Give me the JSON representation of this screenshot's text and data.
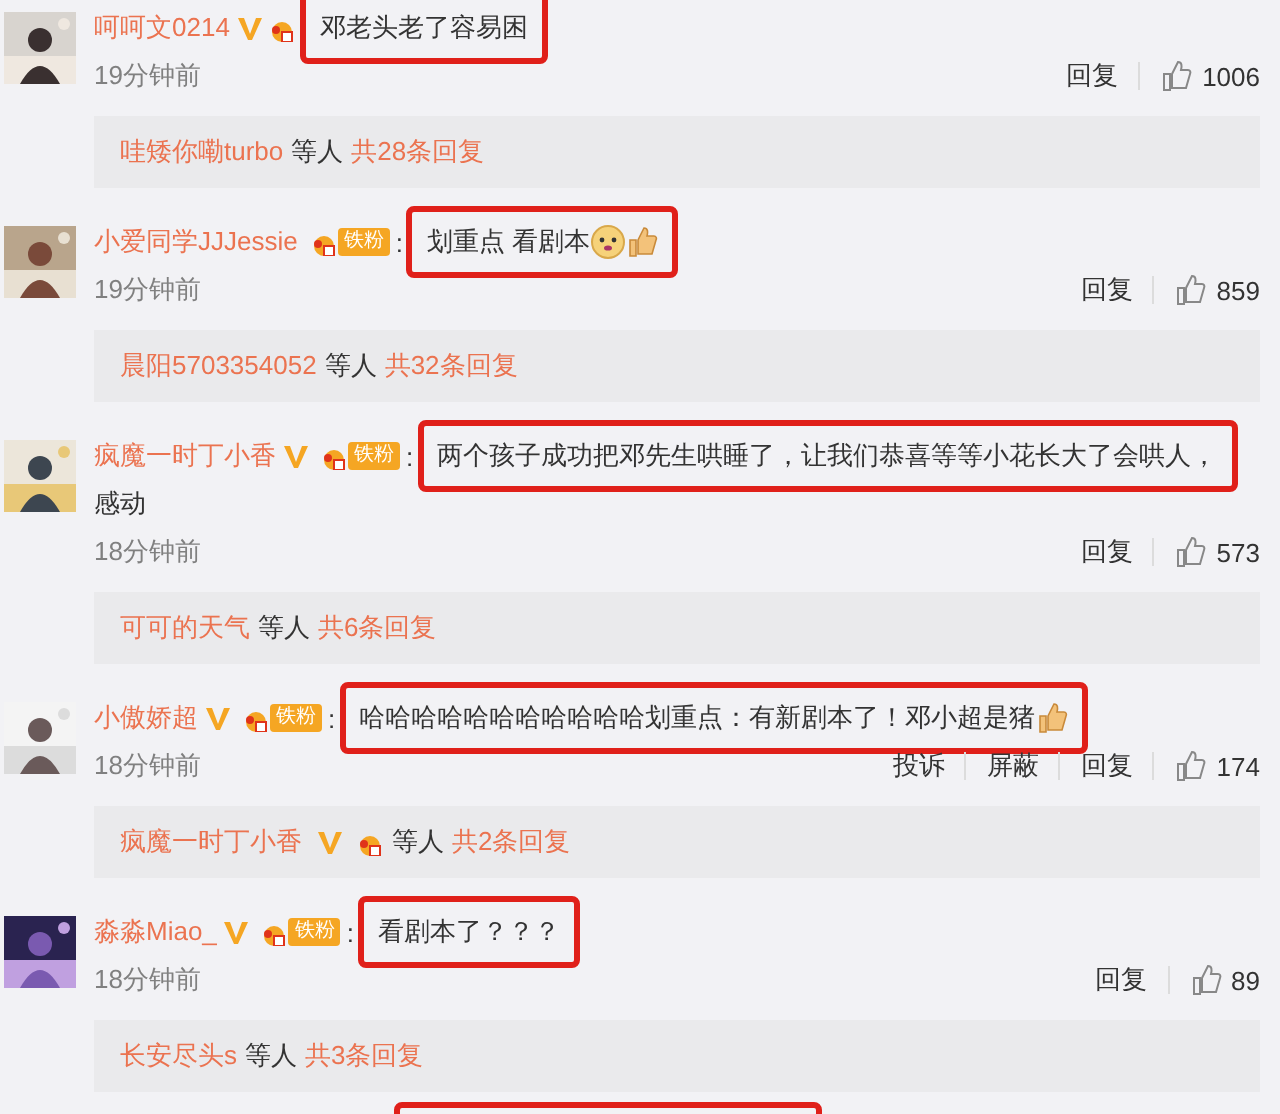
{
  "comments": [
    {
      "user": "呵呵文0214",
      "vip": true,
      "crown": true,
      "lines": [
        "邓老头老了容易困"
      ],
      "highlighted": true,
      "time": "19分钟前",
      "actions": [
        "回复"
      ],
      "likes": "1006",
      "replies": {
        "name": "哇矮你嘞turbo",
        "vip": false,
        "crown": false,
        "others": "等人",
        "count": "共28条回复"
      }
    },
    {
      "user": "小爱同学JJJessie",
      "vip": false,
      "crown": true,
      "fan_badge": "铁粉",
      "colon": ":",
      "lines": [
        "划重点 看剧本"
      ],
      "emoticons": [
        {
          "kind": "doge"
        },
        {
          "kind": "thumb"
        }
      ],
      "highlighted": true,
      "time": "19分钟前",
      "actions": [
        "回复"
      ],
      "likes": "859",
      "replies": {
        "name": "晨阳5703354052",
        "vip": false,
        "crown": false,
        "others": "等人",
        "count": "共32条回复"
      }
    },
    {
      "user": "疯魔一时丁小香",
      "vip": true,
      "crown": true,
      "fan_badge": "铁粉",
      "colon": ":",
      "lines": [
        "两个孩子成功把邓先生哄睡了，让我们恭喜等等小花长大了会哄人，",
        "感动"
      ],
      "highlighted": true,
      "time": "18分钟前",
      "actions": [
        "回复"
      ],
      "likes": "573",
      "replies": {
        "name": "可可的天气",
        "vip": false,
        "crown": false,
        "others": "等人",
        "count": "共6条回复"
      }
    },
    {
      "user": "小傲娇超",
      "vip": true,
      "crown": true,
      "fan_badge": "铁粉",
      "colon": ":",
      "lines": [
        "哈哈哈哈哈哈哈哈哈哈哈划重点：有新剧本了！邓小超是猪"
      ],
      "emoticons": [
        {
          "kind": "thumb"
        }
      ],
      "highlighted": true,
      "time": "18分钟前",
      "actions": [
        "投诉",
        "屏蔽",
        "回复"
      ],
      "likes": "174",
      "replies": {
        "name": "疯魔一时丁小香",
        "vip": true,
        "crown": true,
        "others": "等人",
        "count": "共2条回复"
      }
    },
    {
      "user": "淼淼Miao_",
      "vip": true,
      "crown": true,
      "fan_badge": "铁粉",
      "colon": ":",
      "lines": [
        "看剧本了？？？"
      ],
      "highlighted": true,
      "time": "18分钟前",
      "actions": [
        "回复"
      ],
      "likes": "89",
      "replies": {
        "name": "长安尽头s",
        "vip": false,
        "crown": false,
        "others": "等人",
        "count": "共3条回复"
      }
    }
  ],
  "next_comment_highlighted": true
}
